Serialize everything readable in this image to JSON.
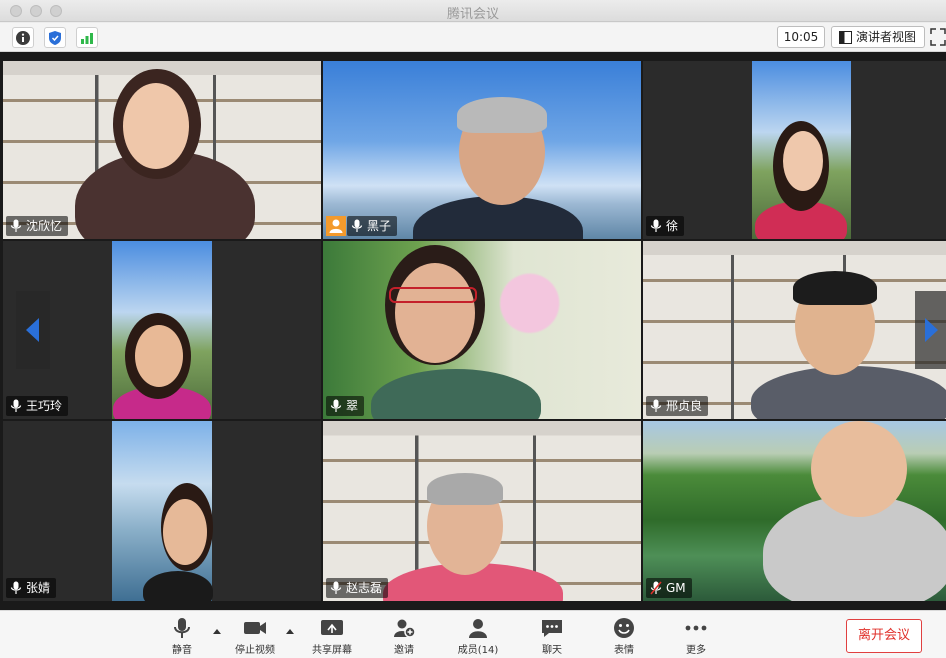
{
  "window": {
    "title": "腾讯会议"
  },
  "infobar": {
    "clock": "10:05",
    "view_label": "演讲者视图"
  },
  "tiles": [
    {
      "name": "沈欣忆"
    },
    {
      "name": "黑子"
    },
    {
      "name": "徐"
    },
    {
      "name": "王巧玲"
    },
    {
      "name": "翠"
    },
    {
      "name": "邢贞良"
    },
    {
      "name": "张婧"
    },
    {
      "name": "赵志磊"
    },
    {
      "name": "GM"
    }
  ],
  "toolbar": {
    "mute": "静音",
    "stop_video": "停止视频",
    "share_screen": "共享屏幕",
    "invite": "邀请",
    "members": "成员(14)",
    "chat": "聊天",
    "reactions": "表情",
    "more": "更多",
    "leave": "离开会议"
  },
  "colors": {
    "active_speaker": "#3ad14e",
    "leave": "#e0302a",
    "host_badge": "#f39a2c",
    "nav_arrow": "#2a6fd8"
  }
}
